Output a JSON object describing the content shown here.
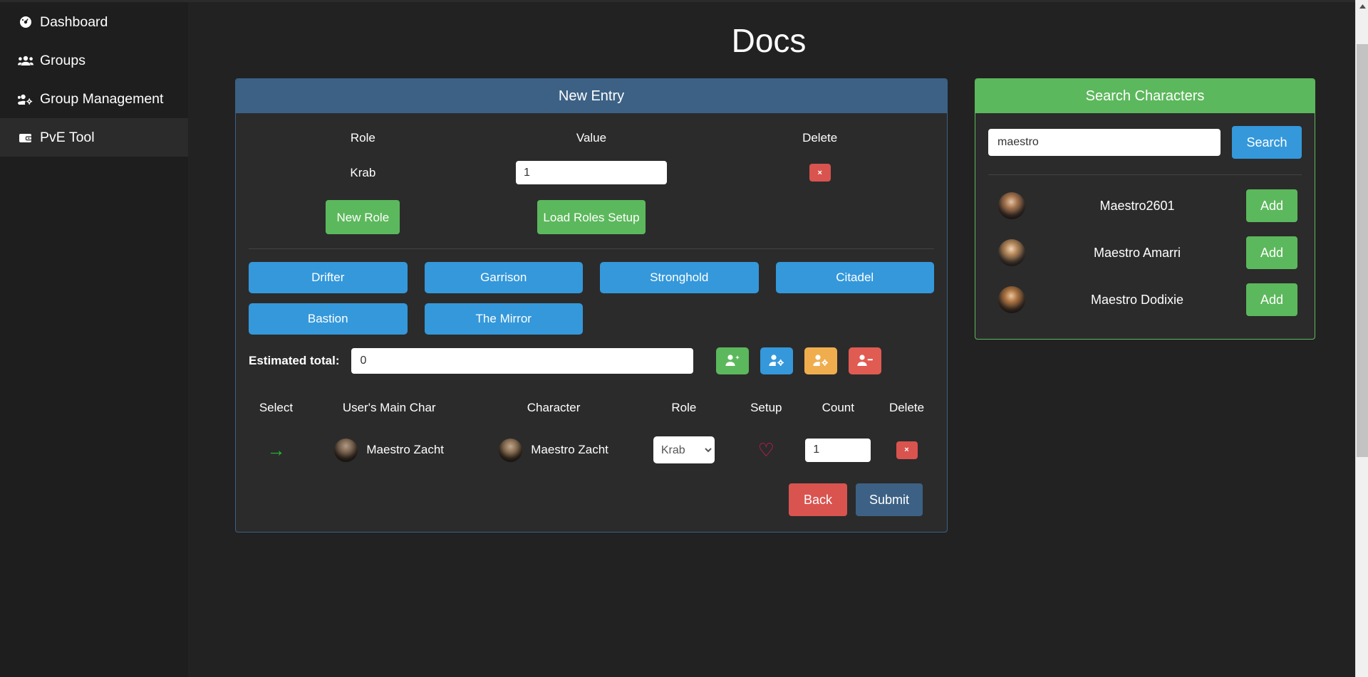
{
  "sidebar": {
    "items": [
      {
        "label": "Dashboard",
        "icon": "tachometer-icon",
        "active": false
      },
      {
        "label": "Groups",
        "icon": "users-icon",
        "active": false
      },
      {
        "label": "Group Management",
        "icon": "users-cog-icon",
        "active": false
      },
      {
        "label": "PvE Tool",
        "icon": "wallet-icon",
        "active": true
      }
    ]
  },
  "header": {
    "title": "Docs"
  },
  "new_entry": {
    "title": "New Entry",
    "columns": {
      "role": "Role",
      "value": "Value",
      "delete": "Delete"
    },
    "rows": [
      {
        "role": "Krab",
        "value": "1",
        "delete_label": "×"
      }
    ],
    "new_role_label": "New Role",
    "load_roles_label": "Load Roles Setup",
    "site_buttons": [
      "Drifter",
      "Garrison",
      "Stronghold",
      "Citadel",
      "Bastion",
      "The Mirror"
    ],
    "estimated_total_label": "Estimated total:",
    "estimated_total_value": "0",
    "icon_buttons": [
      {
        "name": "add-user-icon",
        "color": "#5cb85c"
      },
      {
        "name": "user-settings-icon",
        "color": "#3498db"
      },
      {
        "name": "user-config-icon",
        "color": "#f0ad4e"
      },
      {
        "name": "remove-user-icon",
        "color": "#e05b52"
      }
    ],
    "members_table": {
      "headers": [
        "Select",
        "User's Main Char",
        "Character",
        "Role",
        "Setup",
        "Count",
        "Delete"
      ],
      "rows": [
        {
          "select": "→",
          "main_char": "Maestro Zacht",
          "character": "Maestro Zacht",
          "role": "Krab",
          "role_options": [
            "Krab"
          ],
          "setup": "♡",
          "count": "1",
          "delete_label": "×"
        }
      ]
    },
    "back_label": "Back",
    "submit_label": "Submit"
  },
  "search_panel": {
    "title": "Search Characters",
    "query": "maestro",
    "placeholder": "",
    "search_label": "Search",
    "results": [
      {
        "name": "Maestro2601",
        "add_label": "Add"
      },
      {
        "name": "Maestro Amarri",
        "add_label": "Add"
      },
      {
        "name": "Maestro Dodixie",
        "add_label": "Add"
      }
    ]
  },
  "colors": {
    "page_bg": "#222222",
    "sidebar_bg": "#1e1e1e",
    "card_bg": "#2b2b2b",
    "primary_blue": "#3498db",
    "header_blue": "#3c6185",
    "green": "#5cb85c",
    "orange": "#f0ad4e",
    "red": "#d9534f",
    "heart_pink": "#e8175d"
  }
}
